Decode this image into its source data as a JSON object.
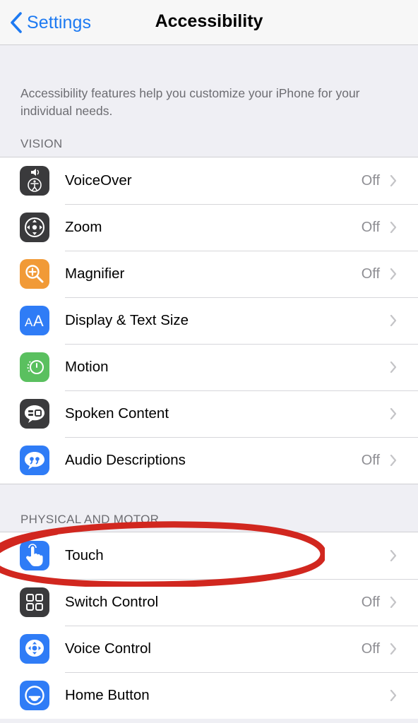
{
  "navbar": {
    "back_label": "Settings",
    "title": "Accessibility"
  },
  "intro_text": "Accessibility features help you customize your iPhone for your individual needs.",
  "sections": [
    {
      "header": "VISION",
      "items": [
        {
          "label": "VoiceOver",
          "value": "Off",
          "icon": "voiceover-icon",
          "icon_color": "#3a3a3c"
        },
        {
          "label": "Zoom",
          "value": "Off",
          "icon": "zoom-icon",
          "icon_color": "#3a3a3c"
        },
        {
          "label": "Magnifier",
          "value": "Off",
          "icon": "magnifier-icon",
          "icon_color": "#f19a37"
        },
        {
          "label": "Display & Text Size",
          "value": "",
          "icon": "display-text-size-icon",
          "icon_color": "#2f7cf6"
        },
        {
          "label": "Motion",
          "value": "",
          "icon": "motion-icon",
          "icon_color": "#5ac05f"
        },
        {
          "label": "Spoken Content",
          "value": "",
          "icon": "spoken-content-icon",
          "icon_color": "#3a3a3c"
        },
        {
          "label": "Audio Descriptions",
          "value": "Off",
          "icon": "audio-descriptions-icon",
          "icon_color": "#2f7cf6"
        }
      ]
    },
    {
      "header": "PHYSICAL AND MOTOR",
      "items": [
        {
          "label": "Touch",
          "value": "",
          "icon": "touch-icon",
          "icon_color": "#2f7cf6"
        },
        {
          "label": "Switch Control",
          "value": "Off",
          "icon": "switch-control-icon",
          "icon_color": "#3a3a3c"
        },
        {
          "label": "Voice Control",
          "value": "Off",
          "icon": "voice-control-icon",
          "icon_color": "#2f7cf6"
        },
        {
          "label": "Home Button",
          "value": "",
          "icon": "home-button-icon",
          "icon_color": "#2f7cf6"
        }
      ]
    }
  ],
  "colors": {
    "accent": "#1d7af2",
    "annotation_ring": "#d1271f"
  }
}
